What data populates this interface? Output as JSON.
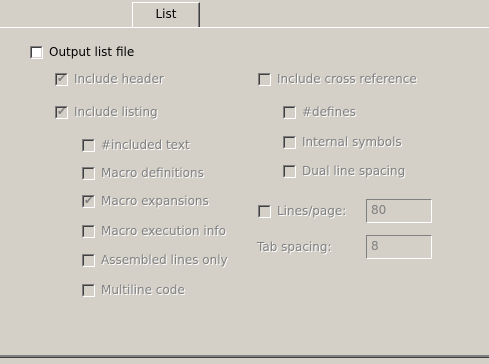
{
  "tabs": [
    {
      "label": "List",
      "active": true
    }
  ],
  "output_list_file": {
    "label": "Output list file",
    "checked": false,
    "enabled": true
  },
  "left_options": [
    {
      "label": "Include header",
      "checked": true
    },
    {
      "label": "Include listing",
      "checked": true
    },
    {
      "label": "#included text",
      "checked": false
    },
    {
      "label": "Macro definitions",
      "checked": false
    },
    {
      "label": "Macro expansions",
      "checked": true
    },
    {
      "label": "Macro execution info",
      "checked": false
    },
    {
      "label": "Assembled lines only",
      "checked": false
    },
    {
      "label": "Multiline code",
      "checked": false
    }
  ],
  "right_options": [
    {
      "label": "Include cross reference",
      "checked": false
    },
    {
      "label": "#defines",
      "checked": false
    },
    {
      "label": "Internal symbols",
      "checked": false
    },
    {
      "label": "Dual line spacing",
      "checked": false
    }
  ],
  "lines_per_page": {
    "label": "Lines/page:",
    "checked": false,
    "value": "80"
  },
  "tab_spacing": {
    "label": "Tab spacing:",
    "value": "8"
  },
  "colors": {
    "background": "#d4d0c8",
    "disabled_text": "#808080"
  }
}
